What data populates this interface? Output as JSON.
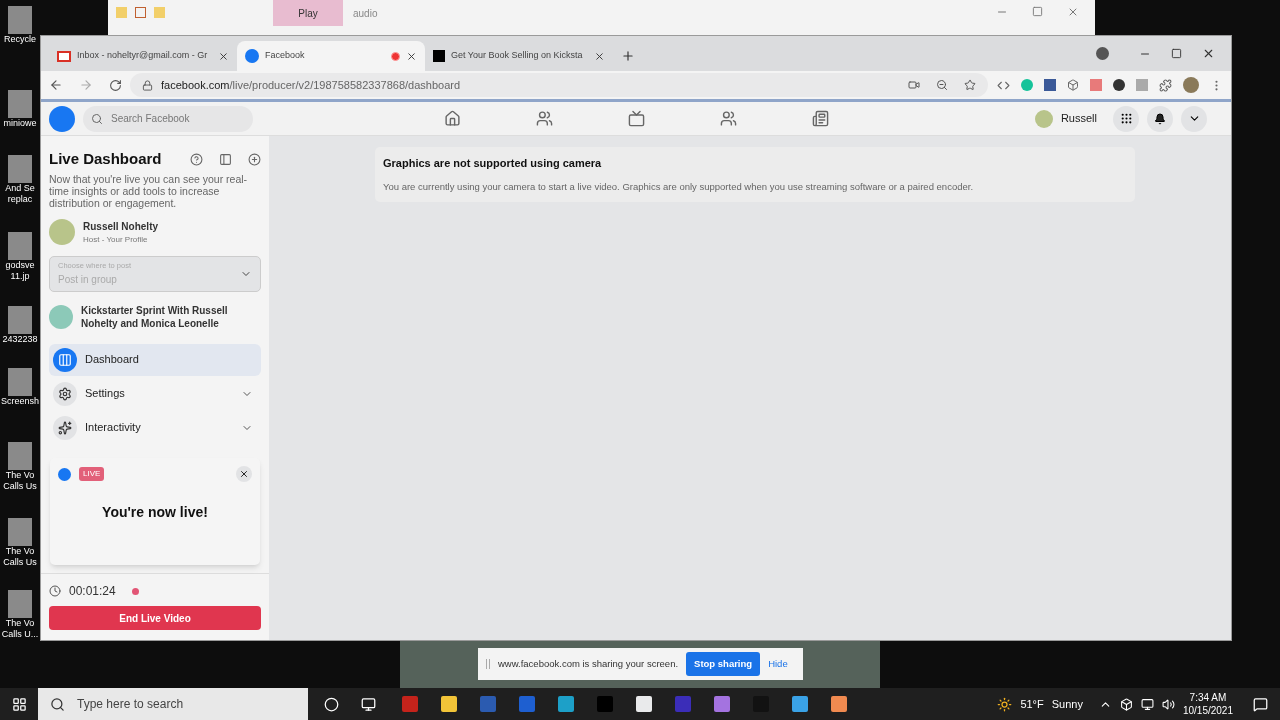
{
  "desktop_icons": [
    {
      "lines": [
        "Recycle"
      ]
    },
    {
      "lines": [
        "miniowe"
      ]
    },
    {
      "lines": [
        "And Se",
        "replac"
      ]
    },
    {
      "lines": [
        "godsve",
        "11.jp"
      ]
    },
    {
      "lines": [
        "2432238"
      ]
    },
    {
      "lines": [
        "Screensh"
      ]
    },
    {
      "lines": [
        "The Vo",
        "Calls Us"
      ]
    },
    {
      "lines": [
        "The Vo",
        "Calls Us"
      ]
    },
    {
      "lines": [
        "The Vo",
        "Calls U..."
      ]
    }
  ],
  "explorer_window": {
    "context_tab": "Play",
    "title": "audio"
  },
  "browser": {
    "tabs": [
      {
        "title": "Inbox - noheltyr@gmail.com - Gr",
        "kind": "mail",
        "selected": false,
        "recording": false
      },
      {
        "title": "Facebook",
        "kind": "facebook",
        "selected": true,
        "recording": true
      },
      {
        "title": "Get Your Book Selling on Kicksta",
        "kind": "kickstarter",
        "selected": false,
        "recording": false
      }
    ],
    "address": {
      "host": "facebook.com",
      "path": "/live/producer/v2/198758582337868/dashboard"
    }
  },
  "facebook_header": {
    "search": {
      "placeholder": "Search Facebook"
    },
    "profile_name": "Russell"
  },
  "sidebar": {
    "title": "Live Dashboard",
    "description": "Now that you're live you can see your real-time insights or add tools to increase distribution or engagement.",
    "host": {
      "name": "Russell Nohelty",
      "role": "Host - Your Profile"
    },
    "post_select": {
      "label": "Choose where to post",
      "value": "Post in group"
    },
    "group": "Kickstarter Sprint With Russell Nohelty and Monica Leonelle",
    "menu": [
      {
        "label": "Dashboard",
        "kind": "dashboard",
        "selected": true
      },
      {
        "label": "Settings",
        "kind": "settings",
        "selected": false,
        "expanded": false
      },
      {
        "label": "Interactivity",
        "kind": "interactivity",
        "selected": false,
        "expanded": false
      }
    ],
    "live_popup": {
      "badge": "LIVE",
      "message": "You're now live!"
    },
    "timer": "00:01:24",
    "end_button": "End Live Video"
  },
  "notice": {
    "title": "Graphics are not supported using camera",
    "body": "You are currently using your camera to start a live video. Graphics are only supported when you use streaming software or a paired encoder."
  },
  "share_bar": {
    "message": "www.facebook.com is sharing your screen.",
    "stop": "Stop sharing",
    "hide": "Hide"
  },
  "taskbar": {
    "search": {
      "placeholder": "Type here to search"
    },
    "weather": {
      "temperature": "51°F",
      "condition": "Sunny"
    },
    "time": "7:34 AM",
    "date": "10/15/2021"
  }
}
